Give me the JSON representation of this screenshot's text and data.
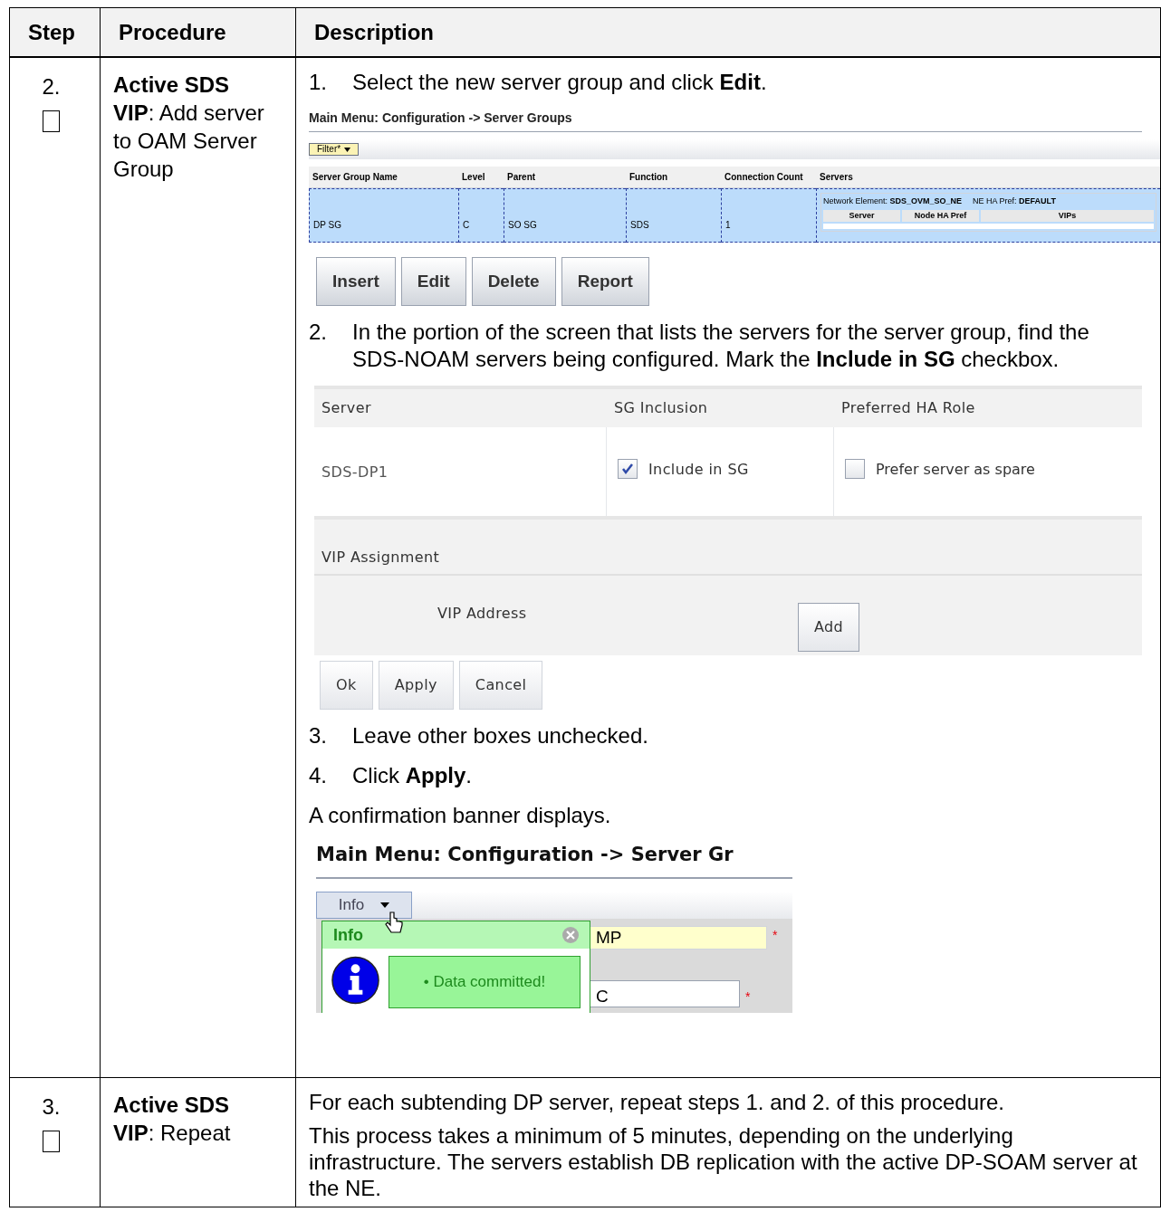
{
  "table": {
    "columns": [
      "Step",
      "Procedure",
      "Description"
    ],
    "rows": [
      {
        "step": "2.",
        "checked": false,
        "procedure": "**Active SDS VIP**:  Add server to OAM Server Group",
        "description": [
          {
            "kind": "numbered",
            "number": "1.",
            "text": "Select the new server group and click **Edit**."
          },
          {
            "kind": "groups_screen",
            "title": "Main Menu: Configuration -> Server Groups",
            "filter": "Filter*",
            "columns": [
              "Server Group Name",
              "Level",
              "Parent",
              "Function",
              "Connection Count",
              "Servers"
            ],
            "cells": [
              "DP  SG",
              "C",
              "SO  SG",
              "SDS",
              "1"
            ],
            "ne_label": "Network Element:",
            "ne_value": "SDS_OVM_SO_NE",
            "pref_label": "NE HA Pref:",
            "pref_value": "DEFAULT",
            "server_columns": [
              "Server",
              "Node HA Pref",
              "VIPs"
            ],
            "buttons": [
              "Insert",
              "Edit",
              "Delete",
              "Report"
            ]
          },
          {
            "kind": "numbered",
            "number": "2.",
            "text": "In the portion of the screen that lists the servers for the server group, find the SDS-NOAM servers being configured.  Mark the **Include in SG** checkbox."
          },
          {
            "kind": "edit_screen",
            "columns": [
              "Server",
              "SG Inclusion",
              "Preferred HA Role"
            ],
            "server": "SDS-DP1",
            "include": {
              "label": "Include in SG",
              "checked": true
            },
            "spare": {
              "label": "Prefer server as spare",
              "checked": false
            },
            "vip_title": "VIP Assignment",
            "vip_label": "VIP Address",
            "add": "Add",
            "buttons": [
              "Ok",
              "Apply",
              "Cancel"
            ]
          },
          {
            "kind": "numbered",
            "number": "3.",
            "text": "Leave other boxes unchecked."
          },
          {
            "kind": "numbered",
            "number": "4.",
            "text": "Click **Apply**."
          },
          {
            "kind": "para",
            "text": "A confirmation banner displays."
          },
          {
            "kind": "banner_screen",
            "title": "Main Menu: Configuration -> Server Gr",
            "info_button": "Info",
            "popup_title": "Info",
            "message": "• Data committed!",
            "field_value": "MP",
            "select_value": "C",
            "required": "*"
          }
        ]
      },
      {
        "step": "3.",
        "checked": false,
        "procedure": "**Active SDS VIP**:  Repeat",
        "description": [
          {
            "kind": "para",
            "text": "For each subtending DP server, repeat steps 1. and 2. of this procedure."
          },
          {
            "kind": "para",
            "text": "This process takes a minimum of 5 minutes, depending on the underlying infrastructure.  The servers establish DB replication with the active DP-SOAM server at the NE."
          }
        ]
      }
    ]
  }
}
